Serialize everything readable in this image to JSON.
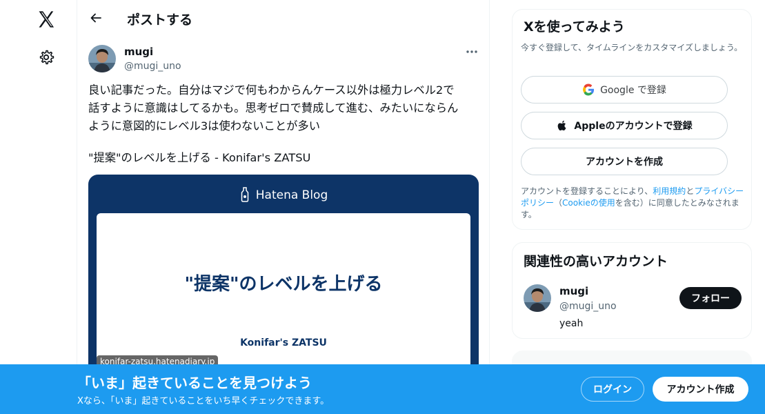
{
  "nav": {
    "logo_icon": "x-logo-icon",
    "settings_icon": "gear-icon"
  },
  "header": {
    "back_icon": "arrow-left-icon",
    "title": "ポストする"
  },
  "post": {
    "author_name": "mugi",
    "author_handle": "@mugi_uno",
    "text": "良い記事だった。自分はマジで何もわからんケース以外は極力レベル2で\n話すように意識はしてるかも。思考ゼロで賛成して進む、みたいにならん\nように意図的にレベル3は使わないことが多い",
    "link_title": "\"提案\"のレベルを上げる - Konifar's ZATSU",
    "card": {
      "brand": "Hatena Blog",
      "headline": "\"提案\"のレベルを上げる",
      "subtitle": "Konifar's ZATSU",
      "domain": "konifar-zatsu.hatenadiary.jp",
      "bg_color": "#0d3467"
    }
  },
  "signup_panel": {
    "title": "Xを使ってみよう",
    "subtitle": "今すぐ登録して、タイムラインをカスタマイズしましょう。",
    "google_button": "Google で登録",
    "apple_button": "Appleのアカウントで登録",
    "create_button": "アカウントを作成",
    "legal": {
      "part1": "アカウントを登録することにより、",
      "terms": "利用規約",
      "part2": "と",
      "privacy": "プライバシーポリシー",
      "part3": "（",
      "cookie": "Cookieの使用",
      "part4": "を含む）に同意したとみなされます。"
    }
  },
  "related_panel": {
    "title": "関連性の高いアカウント",
    "name": "mugi",
    "handle": "@mugi_uno",
    "bio": "yeah",
    "follow_button": "フォロー"
  },
  "banner": {
    "title": "「いま」起きていることを見つけよう",
    "subtitle": "Xなら、「いま」起きていることをいち早くチェックできます。",
    "login_button": "ログイン",
    "signup_button": "アカウント作成",
    "bg_color": "#1d9bf0"
  }
}
